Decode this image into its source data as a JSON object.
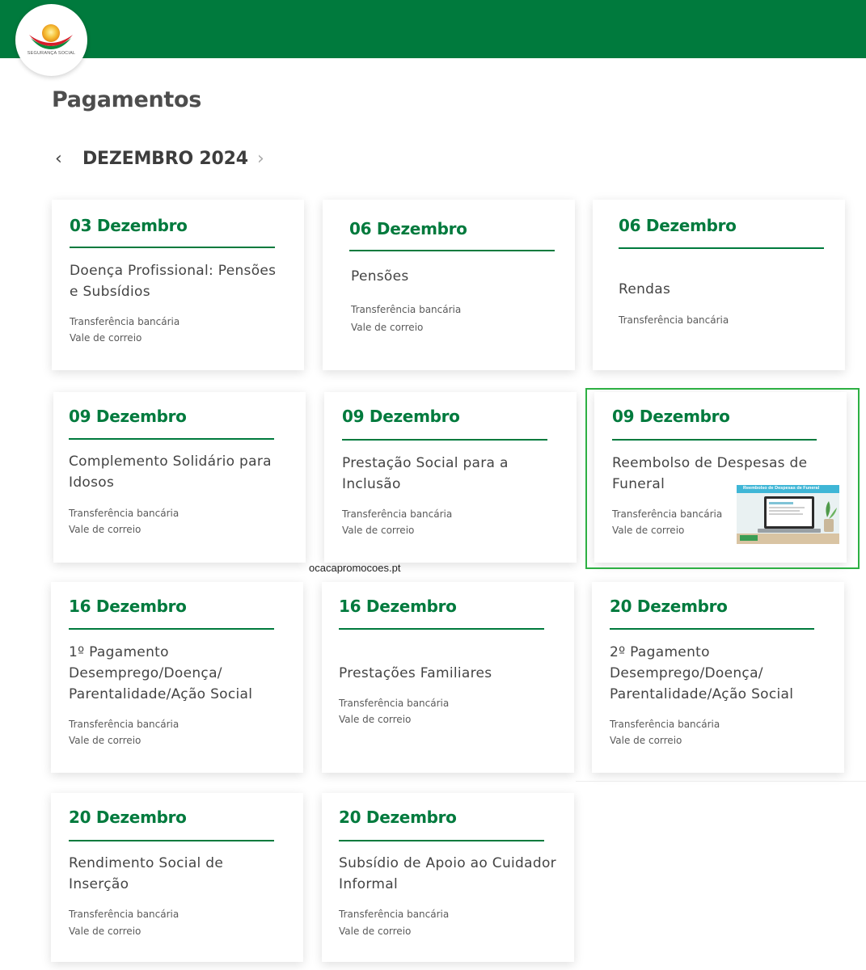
{
  "header": {
    "logo_text": "SEGURANÇA SOCIAL",
    "brand_color": "#007a3d"
  },
  "page": {
    "title": "Pagamentos"
  },
  "month_nav": {
    "label": "DEZEMBRO 2024",
    "prev_icon": "chevron-left-icon",
    "next_icon": "chevron-right-icon"
  },
  "cards": [
    {
      "date": "03 Dezembro",
      "title": "Doença Profissional: Pensões e Subsídios",
      "methods": [
        "Transferência bancária",
        "Vale de correio"
      ]
    },
    {
      "date": "06 Dezembro",
      "title": "Pensões",
      "methods": [
        "Transferência bancária",
        "Vale de correio"
      ]
    },
    {
      "date": "06 Dezembro",
      "title": "Rendas",
      "methods": [
        "Transferência bancária"
      ]
    },
    {
      "date": "09 Dezembro",
      "title": "Complemento Solidário para Idosos",
      "methods": [
        "Transferência bancária",
        "Vale de correio"
      ]
    },
    {
      "date": "09 Dezembro",
      "title": "Prestação Social para a Inclusão",
      "methods": [
        "Transferência bancária",
        "Vale de correio"
      ]
    },
    {
      "date": "09 Dezembro",
      "title": "Reembolso de Despesas de Funeral",
      "methods": [
        "Transferência bancária",
        "Vale de correio"
      ],
      "thumbnail_caption": "Reembolso de Despesas de Funeral",
      "highlight_color": "#2db043"
    },
    {
      "date": "16 Dezembro",
      "title": "1º Pagamento Desemprego/Doença/ Parentalidade/Ação Social",
      "methods": [
        "Transferência bancária",
        "Vale de correio"
      ]
    },
    {
      "date": "16 Dezembro",
      "title": "Prestações Familiares",
      "methods": [
        "Transferência bancária",
        "Vale de correio"
      ]
    },
    {
      "date": "20 Dezembro",
      "title": "2º Pagamento Desemprego/Doença/ Parentalidade/Ação Social",
      "methods": [
        "Transferência bancária",
        "Vale de correio"
      ]
    },
    {
      "date": "20 Dezembro",
      "title": "Rendimento Social de Inserção",
      "methods": [
        "Transferência bancária",
        "Vale de correio"
      ]
    },
    {
      "date": "20 Dezembro",
      "title": "Subsídio de Apoio ao Cuidador Informal",
      "methods": [
        "Transferência bancária",
        "Vale de correio"
      ]
    }
  ],
  "watermark": "ocacapromocoes.pt"
}
